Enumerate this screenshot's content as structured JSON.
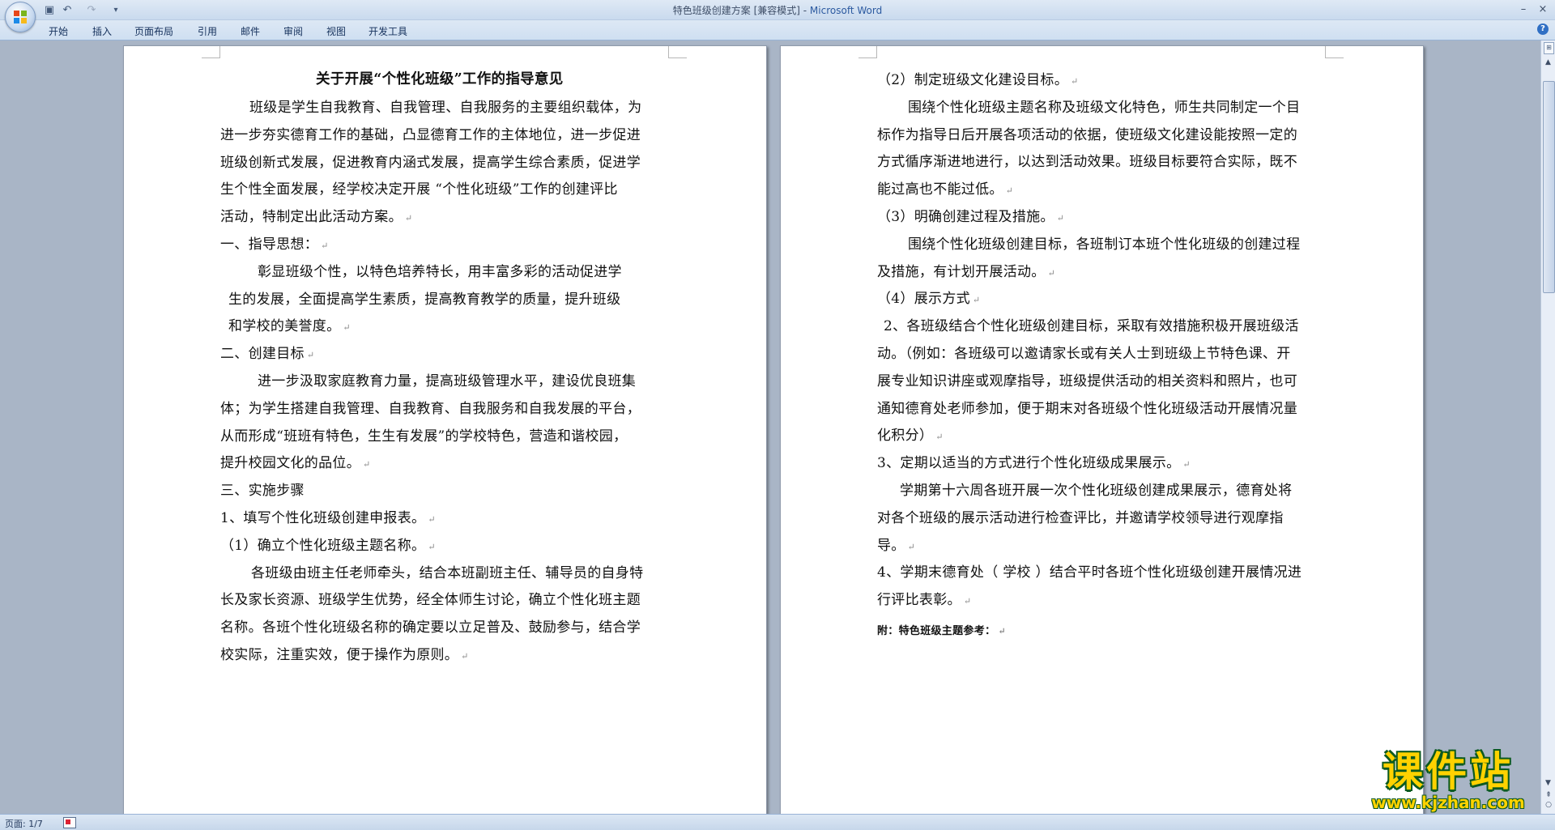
{
  "window": {
    "doc_title": "特色班级创建方案 [兼容模式] - ",
    "app_name": "Microsoft Word",
    "minimize_glyph": "–",
    "close_glyph": "×"
  },
  "quick_access": {
    "save_glyph": "▣",
    "undo_glyph": "↶",
    "redo_glyph": "↷",
    "customize_glyph": "▾"
  },
  "ribbon": {
    "tabs": [
      "开始",
      "插入",
      "页面布局",
      "引用",
      "邮件",
      "审阅",
      "视图",
      "开发工具"
    ],
    "help_glyph": "?"
  },
  "document": {
    "left_page": {
      "title": "关于开展“个性化班级”工作的指导意见",
      "lines": [
        "班级是学生自我教育、自我管理、自我服务的主要组织载体，为",
        "进一步夯实德育工作的基础，凸显德育工作的主体地位，进一步促进",
        "班级创新式发展，促进教育内涵式发展，提高学生综合素质，促进学",
        "生个性全面发展，经学校决定开展 “个性化班级”工作的创建评比",
        "活动，特制定出此活动方案。",
        "一、指导思想：",
        "彰显班级个性，以特色培养特长，用丰富多彩的活动促进学",
        "生的发展，全面提高学生素质，提高教育教学的质量，提升班级",
        "和学校的美誉度。",
        "二、创建目标",
        "进一步汲取家庭教育力量，提高班级管理水平，建设优良班集",
        "体；为学生搭建自我管理、自我教育、自我服务和自我发展的平台，",
        "从而形成“班班有特色，生生有发展”的学校特色，营造和谐校园，",
        "提升校园文化的品位。",
        "三、实施步骤",
        "1、填写个性化班级创建申报表。",
        "（1）确立个性化班级主题名称。",
        "各班级由班主任老师牵头，结合本班副班主任、辅导员的自身特",
        "长及家长资源、班级学生优势，经全体师生讨论，确立个性化班主题",
        "名称。各班个性化班级名称的确定要以立足普及、鼓励参与，结合学",
        "校实际，注重实效，便于操作为原则。"
      ]
    },
    "right_page": {
      "lines": [
        "（2）制定班级文化建设目标。",
        "围绕个性化班级主题名称及班级文化特色，师生共同制定一个目",
        "标作为指导日后开展各项活动的依据，使班级文化建设能按照一定的",
        "方式循序渐进地进行，以达到活动效果。班级目标要符合实际，既不",
        "能过高也不能过低。",
        "（3）明确创建过程及措施。",
        "围绕个性化班级创建目标，各班制订本班个性化班级的创建过程",
        "及措施，有计划开展活动。",
        "（4）展示方式",
        "2、各班级结合个性化班级创建目标，采取有效措施积极开展班级活",
        "动。（例如：各班级可以邀请家长或有关人士到班级上节特色课、开",
        "展专业知识讲座或观摩指导，班级提供活动的相关资料和照片，也可",
        "通知德育处老师参加，便于期末对各班级个性化班级活动开展情况量",
        "化积分）",
        "3、定期以适当的方式进行个性化班级成果展示。",
        "学期第十六周各班开展一次个性化班级创建成果展示，德育处将",
        "对各个班级的展示活动进行检查评比，并邀请学校领导进行观摩指",
        "导。",
        "4、学期末德育处（ 学校 ）结合平时各班个性化班级创建开展情况进",
        "行评比表彰。",
        "附：特色班级主题参考："
      ]
    },
    "paragraph_mark": "↵"
  },
  "scrollbar": {
    "up_glyph": "▲",
    "down_glyph": "▼",
    "ruler_glyph": "⊞",
    "prev_glyph": "⇞",
    "browse_glyph": "○",
    "next_glyph": "⇟"
  },
  "status": {
    "page_indicator": "页面: 1/7"
  },
  "watermark": {
    "logo_text": "课件站",
    "url": "www.kjzhan.com"
  }
}
